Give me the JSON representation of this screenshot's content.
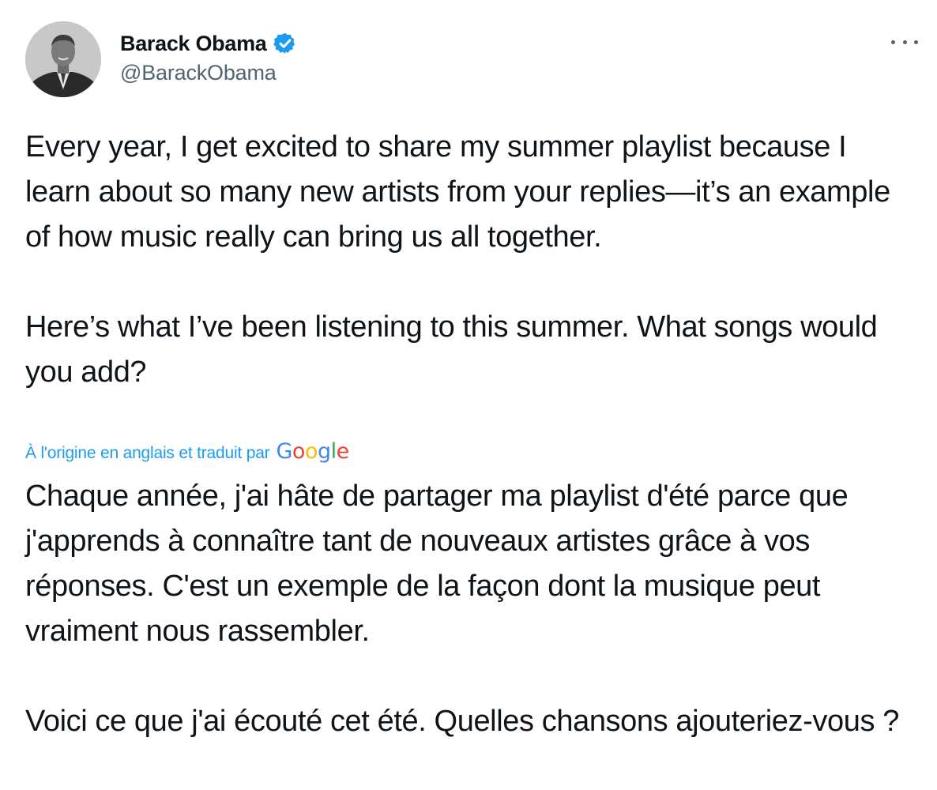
{
  "author": {
    "display_name": "Barack Obama",
    "handle": "@BarackObama",
    "verified": true,
    "avatar_icon": "profile-photo"
  },
  "menu": {
    "icon": "more-options-icon"
  },
  "tweet": {
    "text": "Every year, I get excited to share my summer playlist because I learn about so many new artists from your replies—it’s an example of how music really can bring us all together.\n\nHere’s what I’ve been listening to this summer. What songs would you add?",
    "translation_note": "À l'origine en anglais et traduit par",
    "translation_provider": "Google",
    "translated_text": "Chaque année, j'ai hâte de partager ma playlist d'été parce que j'apprends à connaître tant de nouveaux artistes grâce à vos réponses. C'est un exemple de la façon dont la musique peut vraiment nous rassembler.\n\n Voici ce que j'ai écouté cet été. Quelles chansons ajouteriez-vous ?"
  },
  "colors": {
    "text": "#0f1419",
    "secondary": "#536471",
    "accent": "#1d9bf0",
    "google_blue": "#4285f4",
    "google_red": "#ea4335",
    "google_yellow": "#fbbc05",
    "google_green": "#34a853"
  }
}
